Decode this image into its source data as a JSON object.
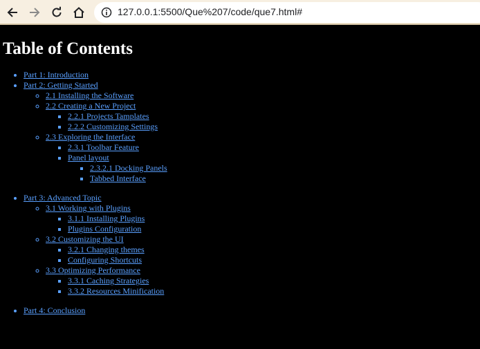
{
  "browser": {
    "url": "127.0.0.1:5500/Que%207/code/que7.html#",
    "accent_color": "#f7efe1",
    "icons": [
      "back-arrow-icon",
      "forward-arrow-icon",
      "reload-icon",
      "home-icon",
      "info-icon"
    ]
  },
  "page": {
    "title": "Table of Contents",
    "link_color": "#5aa0ff",
    "background": "#000000"
  },
  "toc": [
    {
      "label": "Part 1: Introduction",
      "children": []
    },
    {
      "label": "Part 2: Getting Started",
      "children": [
        {
          "label": "2.1 Installing the Software",
          "children": []
        },
        {
          "label": "2.2 Creating a New Project",
          "children": [
            {
              "label": "2.2.1 Projects Tamplates",
              "children": []
            },
            {
              "label": "2.2.2 Customizing Settings",
              "children": []
            }
          ]
        },
        {
          "label": "2.3 Exploring the Interface",
          "children": [
            {
              "label": "2.3.1 Toolbar Feature",
              "children": []
            },
            {
              "label": "Panel layout",
              "children": [
                {
                  "label": "2.3.2.1 Docking Panels"
                },
                {
                  "label": "Tabbed Interface"
                }
              ]
            }
          ]
        }
      ]
    },
    {
      "label": "Part 3: Advanced Topic",
      "children": [
        {
          "label": "3.1 Working with Plugins",
          "children": [
            {
              "label": "3.1.1 Installing Plugins"
            },
            {
              "label": "Plugins Configuration"
            }
          ]
        },
        {
          "label": "3.2 Customizing the UI",
          "children": [
            {
              "label": "3.2.1 Changing themes"
            },
            {
              "label": "Configuring Shortcuts"
            }
          ]
        },
        {
          "label": "3.3 Optimizing Performance",
          "children": [
            {
              "label": "3.3.1 Caching Strategies"
            },
            {
              "label": "3.3.2 Resources Minification"
            }
          ]
        }
      ]
    },
    {
      "label": "Part 4: Conclusion",
      "children": []
    }
  ]
}
